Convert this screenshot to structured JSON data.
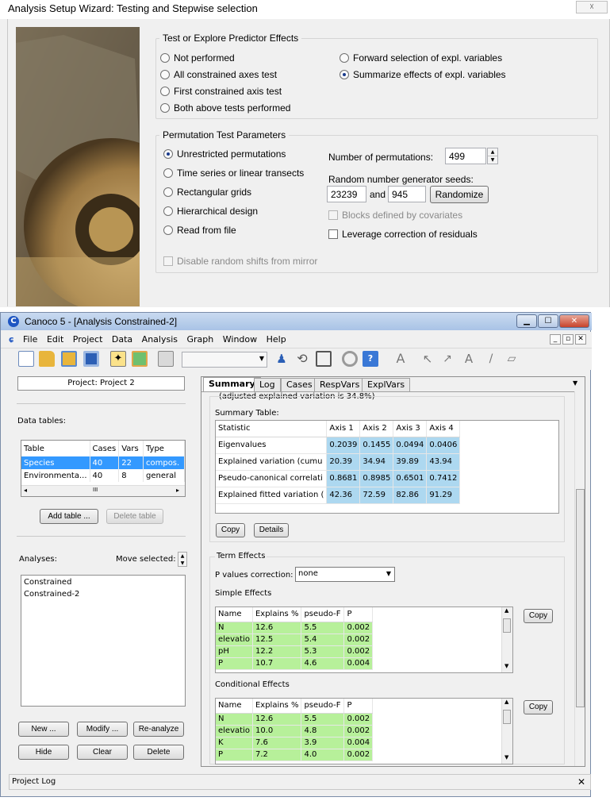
{
  "wizard": {
    "title": "Analysis Setup Wizard: Testing and Stepwise selection",
    "close_glyph": "☓",
    "test_group": {
      "title": "Test or Explore Predictor Effects",
      "options": [
        "Not performed",
        "All constrained axes test",
        "First constrained axis test",
        "Both above tests performed",
        "Forward selection of expl. variables",
        "Summarize effects of expl. variables"
      ],
      "selected": "Summarize effects of expl. variables"
    },
    "perm_group": {
      "title": "Permutation Test Parameters",
      "options": [
        "Unrestricted permutations",
        "Time series or linear transects",
        "Rectangular grids",
        "Hierarchical design",
        "Read from file"
      ],
      "selected": "Unrestricted permutations",
      "num_perm_label": "Number of permutations:",
      "num_perm_value": "499",
      "seeds_label": "Random number generator seeds:",
      "seed1": "23239",
      "and_label": "and",
      "seed2": "945",
      "randomize_label": "Randomize",
      "blocks_label": "Blocks defined by covariates",
      "leverage_label": "Leverage correction of residuals",
      "disable_shifts_label": "Disable random shifts from mirror"
    }
  },
  "canoco": {
    "title": "Canoco 5 - [Analysis Constrained-2]",
    "menu": [
      "File",
      "Edit",
      "Project",
      "Data",
      "Analysis",
      "Graph",
      "Window",
      "Help"
    ],
    "mdi_buttons": [
      "_",
      "▫",
      "✕"
    ],
    "window_buttons": [
      "▁",
      "☐",
      "✕"
    ],
    "left": {
      "project_label": "Project: Project 2",
      "data_tables_label": "Data tables:",
      "table_headers": [
        "Table",
        "Cases",
        "Vars",
        "Type"
      ],
      "table_rows": [
        [
          "Species",
          "40",
          "22",
          "compos."
        ],
        [
          "Environmenta...",
          "40",
          "8",
          "general"
        ]
      ],
      "scroll_mark": "III",
      "add_table_label": "Add table ...",
      "delete_table_label": "Delete table",
      "analyses_label": "Analyses:",
      "move_selected_label": "Move selected:",
      "analyses": [
        "Constrained",
        "Constrained-2"
      ],
      "buttons": [
        "New ...",
        "Modify ...",
        "Re-analyze",
        "Hide",
        "Clear",
        "Delete"
      ]
    },
    "tabs": [
      "Summary",
      "Log",
      "Cases",
      "RespVars",
      "ExplVars"
    ],
    "active_tab": "Summary",
    "summary": {
      "adjusted_text": "(adjusted explained variation is  34.8%)",
      "summary_table_label": "Summary Table:",
      "headers": [
        "Statistic",
        "Axis 1",
        "Axis 2",
        "Axis 3",
        "Axis 4"
      ],
      "rows": [
        [
          "Eigenvalues",
          "0.2039",
          "0.1455",
          "0.0494",
          "0.0406"
        ],
        [
          "Explained variation (cumu",
          "20.39",
          "34.94",
          "39.89",
          "43.94"
        ],
        [
          "Pseudo-canonical correlati",
          "0.8681",
          "0.8985",
          "0.6501",
          "0.7412"
        ],
        [
          "Explained fitted variation (",
          "42.36",
          "72.59",
          "82.86",
          "91.29"
        ]
      ],
      "copy_label": "Copy",
      "details_label": "Details"
    },
    "term_effects": {
      "title": "Term Effects",
      "pcorr_label": "P values correction:",
      "pcorr_value": "none",
      "simple_label": "Simple Effects",
      "conditional_label": "Conditional Effects",
      "headers": [
        "Name",
        "Explains %",
        "pseudo-F",
        "P"
      ],
      "simple_rows": [
        [
          "N",
          "12.6",
          "5.5",
          "0.002"
        ],
        [
          "elevatio",
          "12.5",
          "5.4",
          "0.002"
        ],
        [
          "pH",
          "12.2",
          "5.3",
          "0.002"
        ],
        [
          "P",
          "10.7",
          "4.6",
          "0.004"
        ]
      ],
      "conditional_rows": [
        [
          "N",
          "12.6",
          "5.5",
          "0.002"
        ],
        [
          "elevatio",
          "10.0",
          "4.8",
          "0.002"
        ],
        [
          "K",
          "7.6",
          "3.9",
          "0.004"
        ],
        [
          "P",
          "7.2",
          "4.0",
          "0.002"
        ]
      ],
      "copy_label": "Copy"
    },
    "project_log_label": "Project Log",
    "log_close": "✕"
  },
  "colors": {
    "select_blue": "#3399ff",
    "value_blue": "#add8f0",
    "value_green": "#b7f09a"
  }
}
